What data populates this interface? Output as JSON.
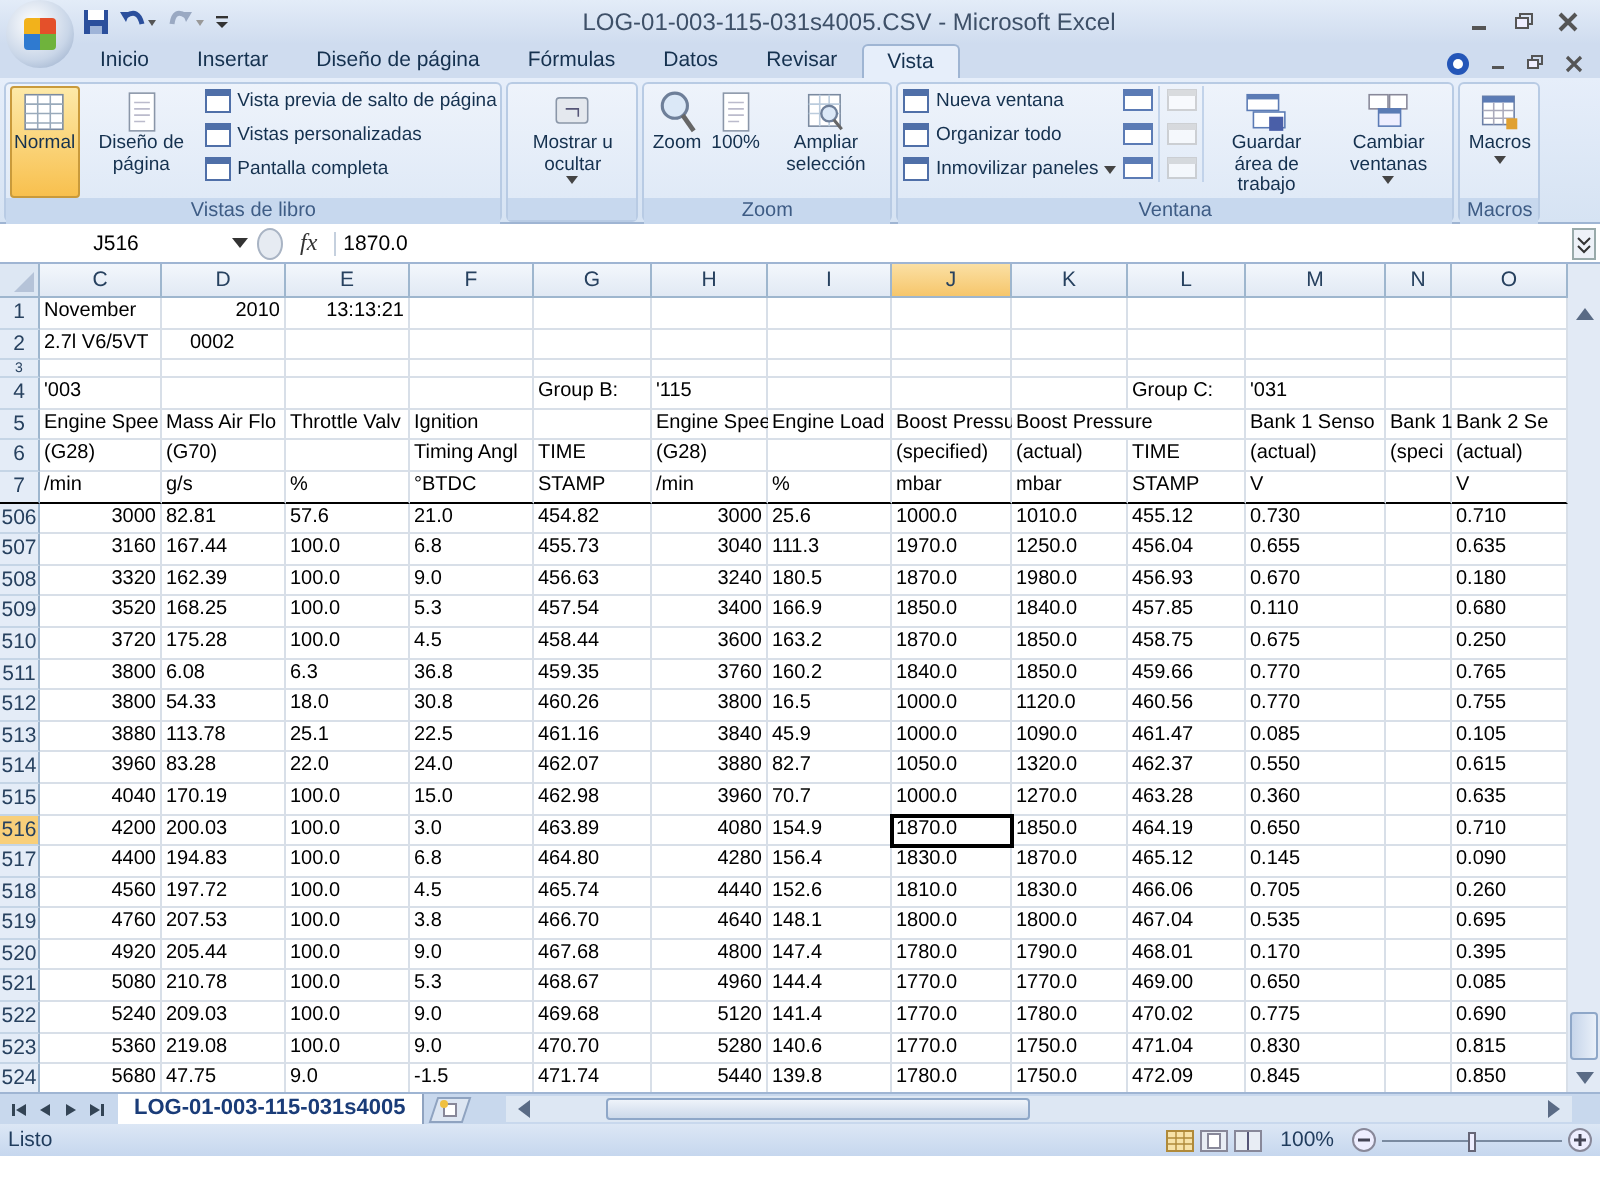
{
  "window": {
    "title": "LOG-01-003-115-031s4005.CSV - Microsoft Excel"
  },
  "tabs": [
    {
      "label": "Inicio",
      "selected": false
    },
    {
      "label": "Insertar",
      "selected": false
    },
    {
      "label": "Diseño de página",
      "selected": false
    },
    {
      "label": "Fórmulas",
      "selected": false
    },
    {
      "label": "Datos",
      "selected": false
    },
    {
      "label": "Revisar",
      "selected": false
    },
    {
      "label": "Vista",
      "selected": true
    }
  ],
  "ribbon_groups": [
    {
      "label": "Vistas de libro",
      "items": [
        {
          "kind": "large",
          "label": "Normal",
          "selected": true
        },
        {
          "kind": "large",
          "label": "Diseño de página",
          "selected": false
        },
        {
          "kind": "small",
          "label": "Vista previa de salto de página"
        },
        {
          "kind": "small",
          "label": "Vistas personalizadas"
        },
        {
          "kind": "small",
          "label": "Pantalla completa"
        }
      ]
    },
    {
      "items": [
        {
          "kind": "large",
          "label": "Mostrar u ocultar",
          "dropdown": true
        }
      ]
    },
    {
      "label": "Zoom",
      "items": [
        {
          "kind": "large",
          "label": "Zoom"
        },
        {
          "kind": "large",
          "label": "100%"
        },
        {
          "kind": "large",
          "label": "Ampliar selección"
        }
      ]
    },
    {
      "label": "Ventana",
      "items": [
        {
          "kind": "small",
          "label": "Nueva ventana"
        },
        {
          "kind": "small",
          "label": "Organizar todo"
        },
        {
          "kind": "small",
          "label": "Inmovilizar paneles",
          "dropdown": true
        },
        {
          "kind": "icon",
          "disabled": false
        },
        {
          "kind": "icon",
          "disabled": false
        },
        {
          "kind": "icon",
          "disabled": false
        },
        {
          "kind": "icon",
          "disabled": true
        },
        {
          "kind": "icon",
          "disabled": true
        },
        {
          "kind": "icon",
          "disabled": true
        },
        {
          "kind": "large",
          "label": "Guardar área de trabajo"
        },
        {
          "kind": "large",
          "label": "Cambiar ventanas",
          "dropdown": true
        }
      ]
    },
    {
      "label": "Macros",
      "items": [
        {
          "kind": "large",
          "label": "Macros",
          "dropdown": true
        }
      ]
    }
  ],
  "formula_bar": {
    "name_box": "J516",
    "function_label": "fx",
    "formula": "1870.0"
  },
  "columns": [
    {
      "letter": "C",
      "kind": "number",
      "selected": false
    },
    {
      "letter": "D",
      "kind": "text",
      "selected": false
    },
    {
      "letter": "E",
      "kind": "text",
      "selected": false
    },
    {
      "letter": "F",
      "kind": "text",
      "selected": false
    },
    {
      "letter": "G",
      "kind": "text",
      "selected": false
    },
    {
      "letter": "H",
      "kind": "number",
      "selected": false
    },
    {
      "letter": "I",
      "kind": "text",
      "selected": false
    },
    {
      "letter": "J",
      "kind": "text",
      "selected": true
    },
    {
      "letter": "K",
      "kind": "text",
      "selected": false
    },
    {
      "letter": "L",
      "kind": "text",
      "selected": false
    },
    {
      "letter": "M",
      "kind": "text",
      "selected": false
    },
    {
      "letter": "N",
      "selected": false
    },
    {
      "letter": "O",
      "kind": "text",
      "selected": false
    }
  ],
  "rows": [
    {
      "num": "1",
      "kind": "label",
      "selected": false,
      "cells": [
        "November",
        {
          "text": "2010",
          "kind": "number"
        },
        {
          "text": "13:13:21",
          "kind": "number"
        }
      ]
    },
    {
      "num": "2",
      "kind": "label",
      "selected": false,
      "cells": [
        "2.7l V6/5VT",
        {
          "text": "0002",
          "kind": "indented"
        }
      ]
    },
    {
      "num": "3",
      "kind": "short",
      "selected": false,
      "cells": []
    },
    {
      "num": "4",
      "kind": "label",
      "selected": false,
      "cells": [
        "'003",
        null,
        null,
        null,
        "Group B:",
        "'115",
        null,
        null,
        null,
        "Group C:",
        "'031"
      ]
    },
    {
      "num": "5",
      "kind": "label",
      "selected": false,
      "cells": [
        "Engine Spee",
        "Mass Air Flo",
        "Throttle Valv",
        "Ignition",
        null,
        "Engine Spee",
        "Engine Load",
        "Boost Pressu",
        "Boost Pressure",
        null,
        "Bank 1 Senso",
        "Bank 1",
        "Bank 2 Se"
      ]
    },
    {
      "num": "6",
      "kind": "label",
      "selected": false,
      "cells": [
        "(G28)",
        "(G70)",
        null,
        "Timing Angl",
        "TIME",
        "(G28)",
        null,
        "(specified)",
        "(actual)",
        "TIME",
        "(actual)",
        "(speci",
        "(actual)"
      ]
    },
    {
      "num": "7",
      "kind": "label",
      "selected": false,
      "cells": [
        "/min",
        "g/s",
        "%",
        "°BTDC",
        "STAMP",
        "/min",
        "%",
        "mbar",
        "mbar",
        "STAMP",
        "V",
        null,
        "V"
      ]
    },
    {
      "num": "506",
      "kind": "data",
      "selected": false,
      "cells": [
        "3000",
        "82.81",
        "57.6",
        "21.0",
        "454.82",
        "3000",
        "25.6",
        "1000.0",
        "1010.0",
        "455.12",
        "0.730",
        null,
        "0.710"
      ]
    },
    {
      "num": "507",
      "kind": "data",
      "selected": false,
      "cells": [
        "3160",
        "167.44",
        "100.0",
        "6.8",
        "455.73",
        "3040",
        "111.3",
        "1970.0",
        "1250.0",
        "456.04",
        "0.655",
        null,
        "0.635"
      ]
    },
    {
      "num": "508",
      "kind": "data",
      "selected": false,
      "cells": [
        "3320",
        "162.39",
        "100.0",
        "9.0",
        "456.63",
        "3240",
        "180.5",
        "1870.0",
        "1980.0",
        "456.93",
        "0.670",
        null,
        "0.180"
      ]
    },
    {
      "num": "509",
      "kind": "data",
      "selected": false,
      "cells": [
        "3520",
        "168.25",
        "100.0",
        "5.3",
        "457.54",
        "3400",
        "166.9",
        "1850.0",
        "1840.0",
        "457.85",
        "0.110",
        null,
        "0.680"
      ]
    },
    {
      "num": "510",
      "kind": "data",
      "selected": false,
      "cells": [
        "3720",
        "175.28",
        "100.0",
        "4.5",
        "458.44",
        "3600",
        "163.2",
        "1870.0",
        "1850.0",
        "458.75",
        "0.675",
        null,
        "0.250"
      ]
    },
    {
      "num": "511",
      "kind": "data",
      "selected": false,
      "cells": [
        "3800",
        "6.08",
        "6.3",
        "36.8",
        "459.35",
        "3760",
        "160.2",
        "1840.0",
        "1850.0",
        "459.66",
        "0.770",
        null,
        "0.765"
      ]
    },
    {
      "num": "512",
      "kind": "data",
      "selected": false,
      "cells": [
        "3800",
        "54.33",
        "18.0",
        "30.8",
        "460.26",
        "3800",
        "16.5",
        "1000.0",
        "1120.0",
        "460.56",
        "0.770",
        null,
        "0.755"
      ]
    },
    {
      "num": "513",
      "kind": "data",
      "selected": false,
      "cells": [
        "3880",
        "113.78",
        "25.1",
        "22.5",
        "461.16",
        "3840",
        "45.9",
        "1000.0",
        "1090.0",
        "461.47",
        "0.085",
        null,
        "0.105"
      ]
    },
    {
      "num": "514",
      "kind": "data",
      "selected": false,
      "cells": [
        "3960",
        "83.28",
        "22.0",
        "24.0",
        "462.07",
        "3880",
        "82.7",
        "1050.0",
        "1320.0",
        "462.37",
        "0.550",
        null,
        "0.615"
      ]
    },
    {
      "num": "515",
      "kind": "data",
      "selected": false,
      "cells": [
        "4040",
        "170.19",
        "100.0",
        "15.0",
        "462.98",
        "3960",
        "70.7",
        "1000.0",
        "1270.0",
        "463.28",
        "0.360",
        null,
        "0.635"
      ]
    },
    {
      "num": "516",
      "kind": "data",
      "selected": true,
      "cells": [
        "4200",
        "200.03",
        "100.0",
        "3.0",
        "463.89",
        "4080",
        "154.9",
        "1870.0",
        "1850.0",
        "464.19",
        "0.650",
        null,
        "0.710"
      ]
    },
    {
      "num": "517",
      "kind": "data",
      "selected": false,
      "cells": [
        "4400",
        "194.83",
        "100.0",
        "6.8",
        "464.80",
        "4280",
        "156.4",
        "1830.0",
        "1870.0",
        "465.12",
        "0.145",
        null,
        "0.090"
      ]
    },
    {
      "num": "518",
      "kind": "data",
      "selected": false,
      "cells": [
        "4560",
        "197.72",
        "100.0",
        "4.5",
        "465.74",
        "4440",
        "152.6",
        "1810.0",
        "1830.0",
        "466.06",
        "0.705",
        null,
        "0.260"
      ]
    },
    {
      "num": "519",
      "kind": "data",
      "selected": false,
      "cells": [
        "4760",
        "207.53",
        "100.0",
        "3.8",
        "466.70",
        "4640",
        "148.1",
        "1800.0",
        "1800.0",
        "467.04",
        "0.535",
        null,
        "0.695"
      ]
    },
    {
      "num": "520",
      "kind": "data",
      "selected": false,
      "cells": [
        "4920",
        "205.44",
        "100.0",
        "9.0",
        "467.68",
        "4800",
        "147.4",
        "1780.0",
        "1790.0",
        "468.01",
        "0.170",
        null,
        "0.395"
      ]
    },
    {
      "num": "521",
      "kind": "data",
      "selected": false,
      "cells": [
        "5080",
        "210.78",
        "100.0",
        "5.3",
        "468.67",
        "4960",
        "144.4",
        "1770.0",
        "1770.0",
        "469.00",
        "0.650",
        null,
        "0.085"
      ]
    },
    {
      "num": "522",
      "kind": "data",
      "selected": false,
      "cells": [
        "5240",
        "209.03",
        "100.0",
        "9.0",
        "469.68",
        "5120",
        "141.4",
        "1770.0",
        "1780.0",
        "470.02",
        "0.775",
        null,
        "0.690"
      ]
    },
    {
      "num": "523",
      "kind": "data",
      "selected": false,
      "cells": [
        "5360",
        "219.08",
        "100.0",
        "9.0",
        "470.70",
        "5280",
        "140.6",
        "1770.0",
        "1750.0",
        "471.04",
        "0.830",
        null,
        "0.815"
      ]
    },
    {
      "num": "524",
      "kind": "data",
      "selected": false,
      "cells": [
        "5680",
        "47.75",
        "9.0",
        "-1.5",
        "471.74",
        "5440",
        "139.8",
        "1780.0",
        "1750.0",
        "472.09",
        "0.845",
        null,
        "0.850"
      ]
    }
  ],
  "sheet_tabs": [
    {
      "label": "LOG-01-003-115-031s4005"
    }
  ],
  "status_bar": {
    "text": "Listo",
    "zoom": "100%",
    "zoom_slider": {
      "level": 0.5
    }
  }
}
